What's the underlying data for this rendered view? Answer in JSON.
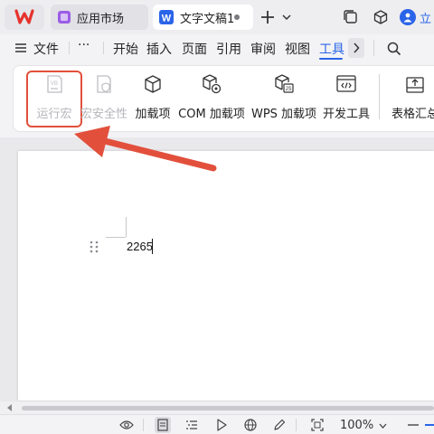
{
  "titlebar": {
    "logo_label": "W",
    "tabs": [
      {
        "label": "应用市场"
      },
      {
        "label": "文字文稿1",
        "badge": "W"
      }
    ],
    "user_label": "立"
  },
  "menubar": {
    "file_label": "文件",
    "more_label": "···",
    "items": [
      {
        "label": "开始"
      },
      {
        "label": "插入"
      },
      {
        "label": "页面"
      },
      {
        "label": "引用"
      },
      {
        "label": "审阅"
      },
      {
        "label": "视图"
      },
      {
        "label": "工具",
        "active": true
      }
    ]
  },
  "ribbon": {
    "buttons": [
      {
        "label": "运行宏",
        "disabled": true,
        "icon": "vb-macro-icon"
      },
      {
        "label": "宏安全性",
        "disabled": true,
        "icon": "macro-security-icon"
      },
      {
        "label": "加载项",
        "disabled": false,
        "icon": "cube-icon"
      },
      {
        "label": "COM 加载项",
        "disabled": false,
        "icon": "com-addin-icon"
      },
      {
        "label": "WPS 加载项",
        "disabled": false,
        "icon": "wps-js-addin-icon"
      },
      {
        "label": "开发工具",
        "disabled": false,
        "icon": "developer-tools-icon"
      },
      {
        "label": "表格汇总",
        "disabled": false,
        "icon": "table-summary-icon"
      }
    ]
  },
  "document": {
    "text": "2265"
  },
  "statusbar": {
    "zoom": "100%"
  },
  "colors": {
    "accent": "#2a64e8",
    "annotation": "#e2503c",
    "wps_red": "#e6322d"
  }
}
